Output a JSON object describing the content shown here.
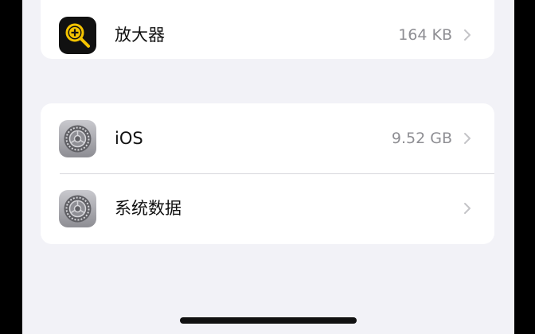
{
  "apps": {
    "magnifier": {
      "name": "放大器",
      "size": "164 KB",
      "icon": "magnifier-icon"
    }
  },
  "system": {
    "ios": {
      "name": "iOS",
      "size": "9.52 GB",
      "icon": "settings-gear-icon"
    },
    "system_data": {
      "name": "系统数据",
      "size": "",
      "icon": "settings-gear-icon"
    }
  },
  "colors": {
    "background": "#f2f2f7",
    "card": "#ffffff",
    "secondary_text": "#8e8e93",
    "magnifier_accent": "#f5c400"
  }
}
